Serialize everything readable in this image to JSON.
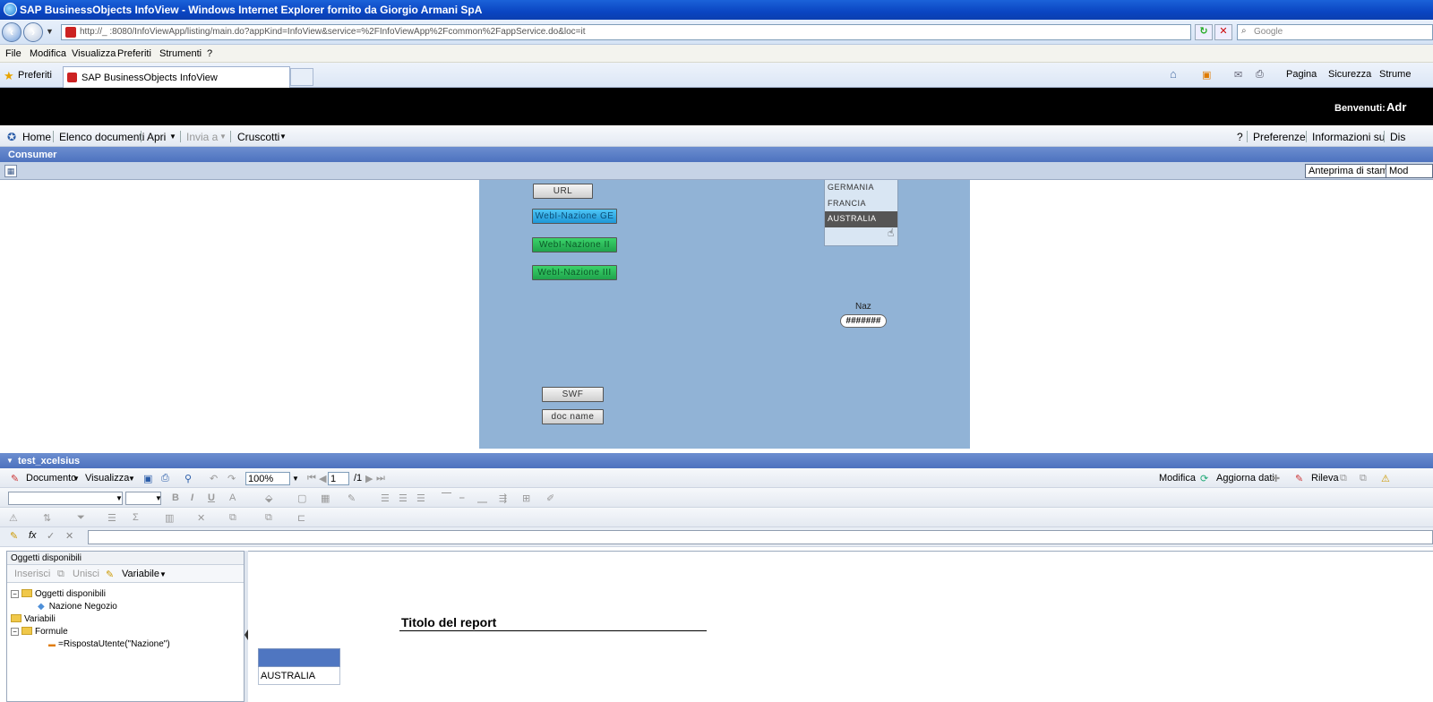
{
  "browser": {
    "title": "SAP BusinessObjects InfoView - Windows Internet Explorer fornito da Giorgio Armani SpA",
    "address": "http://_           :8080/InfoViewApp/listing/main.do?appKind=InfoView&service=%2FInfoViewApp%2Fcommon%2FappService.do&loc=it",
    "search_placeholder": "Google",
    "menu": [
      "File",
      "Modifica",
      "Visualizza",
      "Preferiti",
      "Strumenti",
      "?"
    ],
    "favorites_label": "Preferiti",
    "tab_title": "SAP BusinessObjects InfoView",
    "tools": {
      "page": "Pagina",
      "security": "Sicurezza",
      "tools": "Strume"
    }
  },
  "banner": {
    "welcome": "Benvenuti:",
    "user": "Adr"
  },
  "app_toolbar": {
    "home": "Home",
    "documents": "Elenco documenti",
    "open": "Apri",
    "send": "Invia a",
    "dashboards": "Cruscotti",
    "help": "?",
    "preferences": "Preferenze",
    "about": "Informazioni su",
    "logout": "Dis"
  },
  "consumer": {
    "title": "Consumer",
    "print_preview": "Anteprima di stampa",
    "modify": "Mod"
  },
  "dashboard": {
    "buttons": {
      "url": "URL",
      "webi1": "WebI-Nazione GE",
      "webi2": "WebI-Nazione II",
      "webi3": "WebI-Nazione III",
      "swf": "SWF",
      "docname": "doc name"
    },
    "list": [
      "GERMANIA",
      "FRANCIA",
      "AUSTRALIA"
    ],
    "selected": "AUSTRALIA",
    "naz_label": "Naz",
    "naz_value": "#######"
  },
  "webi": {
    "title": "test_xcelsius",
    "document": "Documento",
    "view": "Visualizza",
    "zoom": "100%",
    "page": "1",
    "page_total": "/1",
    "modify": "Modifica",
    "refresh": "Aggiorna dati",
    "track": "Rileva"
  },
  "left_panel": {
    "title": "Oggetti disponibili",
    "insert": "Inserisci",
    "merge": "Unisci",
    "variable": "Variabile",
    "tree": {
      "root": "Oggetti disponibili",
      "dimension": "Nazione Negozio",
      "variables": "Variabili",
      "formulas": "Formule",
      "formula": "=RispostaUtente(\"Nazione\")"
    }
  },
  "report": {
    "title": "Titolo del report",
    "cell": "AUSTRALIA"
  }
}
